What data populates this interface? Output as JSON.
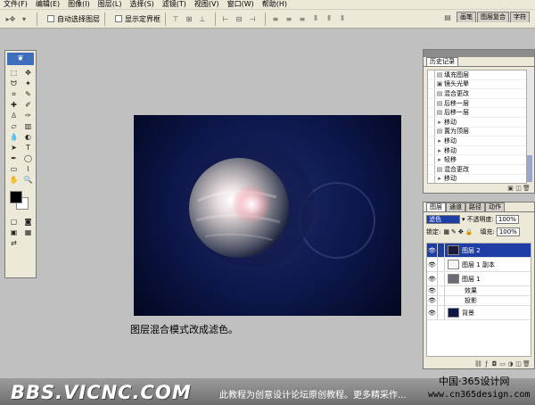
{
  "menu": [
    "文件(F)",
    "编辑(E)",
    "图像(I)",
    "图层(L)",
    "选择(S)",
    "滤镜(T)",
    "视图(V)",
    "窗口(W)",
    "帮助(H)"
  ],
  "options": {
    "auto_select": "自动选择图层",
    "show_bounds": "显示定界框"
  },
  "palette_well": [
    "画笔",
    "图层复合",
    "字符"
  ],
  "history": {
    "tab": "历史记录",
    "items": [
      {
        "label": "填充图层",
        "icon": "layer-icon"
      },
      {
        "label": "镜头光晕",
        "icon": "filter-icon"
      },
      {
        "label": "混合更改",
        "icon": "layer-icon"
      },
      {
        "label": "后移一层",
        "icon": "layer-icon"
      },
      {
        "label": "后移一层",
        "icon": "layer-icon"
      },
      {
        "label": "移动",
        "icon": "move-icon"
      },
      {
        "label": "置为顶层",
        "icon": "layer-icon"
      },
      {
        "label": "移动",
        "icon": "move-icon"
      },
      {
        "label": "移动",
        "icon": "move-icon"
      },
      {
        "label": "轻移",
        "icon": "move-icon"
      },
      {
        "label": "混合更改",
        "icon": "layer-icon"
      },
      {
        "label": "移动",
        "icon": "move-icon"
      },
      {
        "label": "混合更改",
        "icon": "layer-icon",
        "selected": true
      }
    ]
  },
  "layers_panel": {
    "tabs": [
      "图层",
      "通道",
      "路径",
      "动作"
    ],
    "blend_mode": "滤色",
    "opacity_label": "不透明度:",
    "opacity": "100%",
    "fill_label": "填充:",
    "fill": "100%",
    "lock_label": "锁定:",
    "layers": [
      {
        "name": "图层 2",
        "selected": true
      },
      {
        "name": "图层 1 副本"
      },
      {
        "name": "图层 1"
      },
      {
        "name": "效果",
        "sub": true
      },
      {
        "name": "投影",
        "sub": true
      },
      {
        "name": "背景"
      }
    ]
  },
  "caption": "图层混合模式改成滤色。",
  "watermark": {
    "logo": "BBS.VICNC.COM",
    "text": "此教程为创意设计论坛原创教程。更多精采作...",
    "brand_cn": "中国·365设计网",
    "brand_url": "www.cn365design.com"
  },
  "colors": {
    "canvas_bg": "#0c1649",
    "selection": "#1f3ea5",
    "ui_bg": "#ece9d8"
  }
}
